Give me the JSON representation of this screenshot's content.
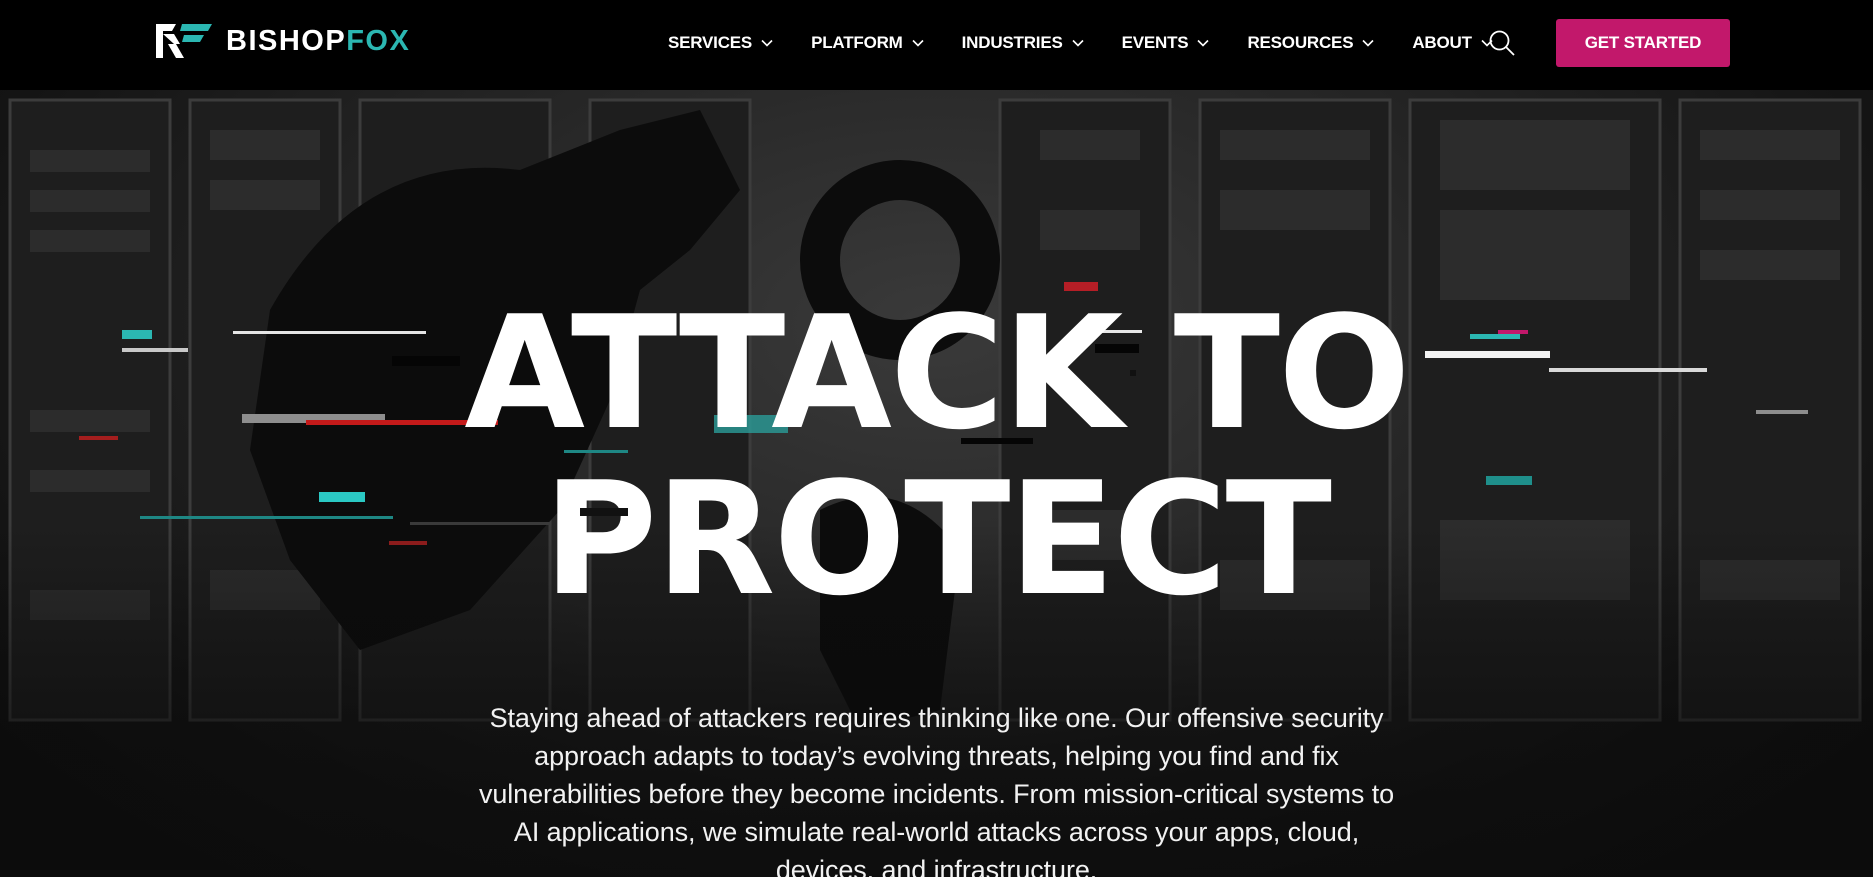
{
  "brand": {
    "name_part1": "BISHOP",
    "name_part2": "FOX",
    "accent_teal": "#2bb7b2",
    "accent_magenta": "#c2186b",
    "logo_icon": "bishopfox-logo-icon"
  },
  "nav": {
    "items": [
      {
        "label": "SERVICES",
        "icon": "chevron-down-icon"
      },
      {
        "label": "PLATFORM",
        "icon": "chevron-down-icon"
      },
      {
        "label": "INDUSTRIES",
        "icon": "chevron-down-icon"
      },
      {
        "label": "EVENTS",
        "icon": "chevron-down-icon"
      },
      {
        "label": "RESOURCES",
        "icon": "chevron-down-icon"
      },
      {
        "label": "ABOUT",
        "icon": "chevron-down-icon"
      }
    ],
    "search_icon": "search-icon",
    "cta_label": "GET STARTED"
  },
  "hero": {
    "headline_line1": "ATTACK TO",
    "headline_line2": "PROTECT",
    "intro": "Staying ahead of attackers requires thinking like one. Our offensive security approach adapts to today’s evolving threats, helping you find and fix vulnerabilities before they become incidents. From mission-critical systems to AI applications, we simulate real-world attacks across your apps, cloud, devices, and infrastructure."
  }
}
